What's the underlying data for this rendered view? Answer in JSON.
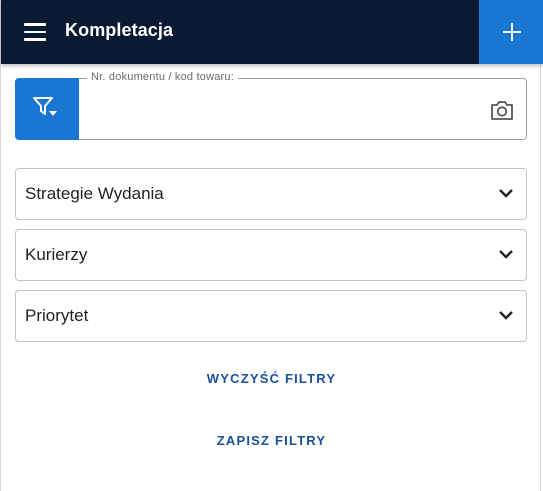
{
  "header": {
    "title": "Kompletacja",
    "menu_icon": "hamburger-menu-icon",
    "add_icon": "plus-icon"
  },
  "search": {
    "legend": "Nr. dokumentu / kod towaru:",
    "value": "",
    "filter_icon": "filter-dropdown-icon",
    "camera_icon": "camera-icon"
  },
  "filters": [
    {
      "label": "Strategie Wydania"
    },
    {
      "label": "Kurierzy"
    },
    {
      "label": "Priorytet"
    }
  ],
  "actions": {
    "clear_label": "WYCZYŚĆ FILTRY",
    "save_label": "ZAPISZ FILTRY"
  },
  "colors": {
    "appbar": "#0a1a33",
    "primary": "#1976d2",
    "link": "#1a4f9c"
  }
}
